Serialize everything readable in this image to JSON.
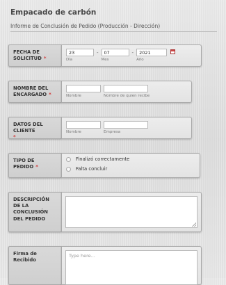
{
  "form": {
    "title": "Empacado de carbón",
    "subtitle": "Informe de Conclusión de Pedido (Producción - Dirección)"
  },
  "fields": {
    "fecha": {
      "label": "FECHA DE SOLICITUD",
      "day": "23",
      "month": "07",
      "year": "2021",
      "day_label": "Día",
      "month_label": "Mes",
      "year_label": "Año",
      "separator": "-"
    },
    "encargado": {
      "label": "NOMBRE DEL ENCARGADO",
      "first_label": "Nombre",
      "second_label": "Nombre de quien recibe",
      "first_value": "",
      "second_value": ""
    },
    "cliente": {
      "label": "DATOS DEL CLIENTE",
      "first_label": "Nombre",
      "second_label": "Empresa",
      "first_value": "",
      "second_value": ""
    },
    "tipo_pedido": {
      "label": "TIPO DE PEDIDO",
      "options": [
        "Finalizó correctamente",
        "Falta concluir"
      ]
    },
    "descripcion": {
      "label": "DESCRIPCIÓN DE LA CONCLUSIÓN DEL PEDIDO",
      "value": ""
    },
    "firma": {
      "label": "Firma de Recibido",
      "placeholder": "Type here..."
    }
  },
  "colors": {
    "required": "#d23a3a",
    "label_bg": "#d4d4d4",
    "field_bg": "#e8e8e8"
  }
}
